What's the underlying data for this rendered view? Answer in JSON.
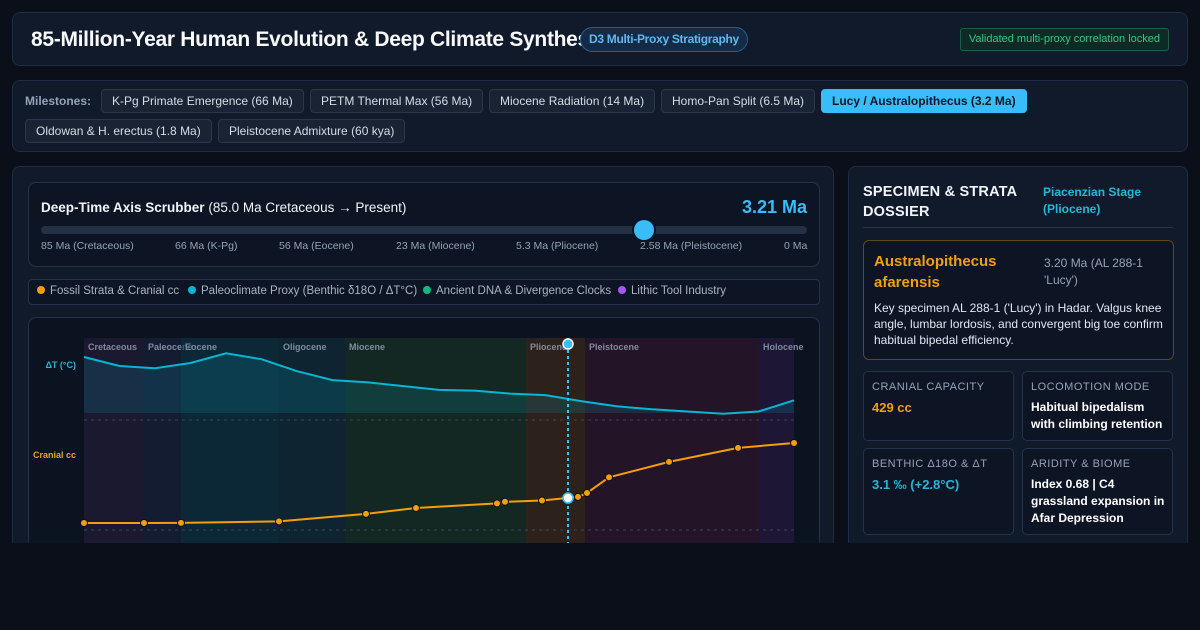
{
  "header": {
    "title": "85-Million-Year Human Evolution & Deep Climate Synthesis",
    "badge": "D3 Multi-Proxy Stratigraphy",
    "status": "Validated multi-proxy correlation locked"
  },
  "milestones": {
    "label": "Milestones:",
    "items": [
      {
        "label": "K-Pg Primate Emergence (66 Ma)",
        "active": false
      },
      {
        "label": "PETM Thermal Max (56 Ma)",
        "active": false
      },
      {
        "label": "Miocene Radiation (14 Ma)",
        "active": false
      },
      {
        "label": "Homo-Pan Split (6.5 Ma)",
        "active": false
      },
      {
        "label": "Lucy / Australopithecus (3.2 Ma)",
        "active": true
      },
      {
        "label": "Oldowan & H. erectus (1.8 Ma)",
        "active": false
      },
      {
        "label": "Pleistocene Admixture (60 kya)",
        "active": false
      }
    ]
  },
  "scrubber": {
    "title_bold": "Deep-Time Axis Scrubber",
    "title_rest": "(85.0 Ma Cretaceous → Present)",
    "value_label": "3.21 Ma",
    "value_ma": 3.21,
    "ticks": [
      "85 Ma (Cretaceous)",
      "66 Ma (K-Pg)",
      "56 Ma (Eocene)",
      "23 Ma (Miocene)",
      "5.3 Ma (Pliocene)",
      "2.58 Ma (Pleistocene)",
      "0 Ma"
    ]
  },
  "legend": [
    {
      "label": "Fossil Strata & Cranial cc",
      "color": "#f59e0b"
    },
    {
      "label": "Paleoclimate Proxy (Benthic δ18O / ΔT°C)",
      "color": "#06b6d4"
    },
    {
      "label": "Ancient DNA & Divergence Clocks",
      "color": "#10b981"
    },
    {
      "label": "Lithic Tool Industry",
      "color": "#a855f7"
    }
  ],
  "chart_data": {
    "type": "line",
    "x_label": "",
    "epochs": [
      {
        "name": "Cretaceous",
        "color": "#2a1f3d"
      },
      {
        "name": "Paleocene",
        "color": "#1e2540"
      },
      {
        "name": "Eocene",
        "color": "#0f3a4a"
      },
      {
        "name": "Oligocene",
        "color": "#123540"
      },
      {
        "name": "Miocene",
        "color": "#1d3a26"
      },
      {
        "name": "Pliocene",
        "color": "#4a2e1a"
      },
      {
        "name": "Pleistocene",
        "color": "#3a1530"
      },
      {
        "name": "Holocene",
        "color": "#2e1a45"
      }
    ],
    "y_labels": {
      "temperature": "ΔT (°C)",
      "cranial": "Cranial cc"
    },
    "series": [
      {
        "name": "ΔT (°C)",
        "color": "#06b6d4",
        "values": [
          7.5,
          6.3,
          6.0,
          6.7,
          8.0,
          7.2,
          5.6,
          4.4,
          4.1,
          3.6,
          3.1,
          3.0,
          2.6,
          2.4,
          1.6,
          0.9,
          0.5,
          0.2,
          -0.1,
          0.2,
          1.7
        ]
      },
      {
        "name": "Cranial cc",
        "color": "#f59e0b",
        "values": [
          0,
          0,
          2,
          25,
          140,
          230,
          300,
          325,
          345,
          400,
          460,
          700,
          935,
          1150,
          1225,
          1190
        ]
      }
    ],
    "cursor_ma": 3.21
  },
  "dossier": {
    "title": "SPECIMEN & STRATA DOSSIER",
    "stage": "Piacenzian Stage (Pliocene)",
    "specimen": {
      "name": "Australopithecus afarensis",
      "id": "3.20 Ma (AL 288-1 'Lucy')",
      "desc": "Key specimen AL 288-1 ('Lucy') in Hadar. Valgus knee angle, lumbar lordosis, and convergent big toe confirm habitual bipedal efficiency."
    },
    "stats": [
      {
        "label": "CRANIAL CAPACITY",
        "value": "429 cc",
        "color": "#f59e0b",
        "big": true
      },
      {
        "label": "LOCOMOTION MODE",
        "value": "Habitual bipedalism with climbing retention",
        "color": "#ffffff",
        "big": false
      },
      {
        "label": "BENTHIC Δ18O & ΔT",
        "value": "3.1 ‰ (+2.8°C)",
        "color": "#22b8d8",
        "big": true
      },
      {
        "label": "ARIDITY & BIOME",
        "value": "Index 0.68 | C4 grassland expansion in Afar Depression",
        "color": "#ffffff",
        "big": false
      }
    ]
  }
}
